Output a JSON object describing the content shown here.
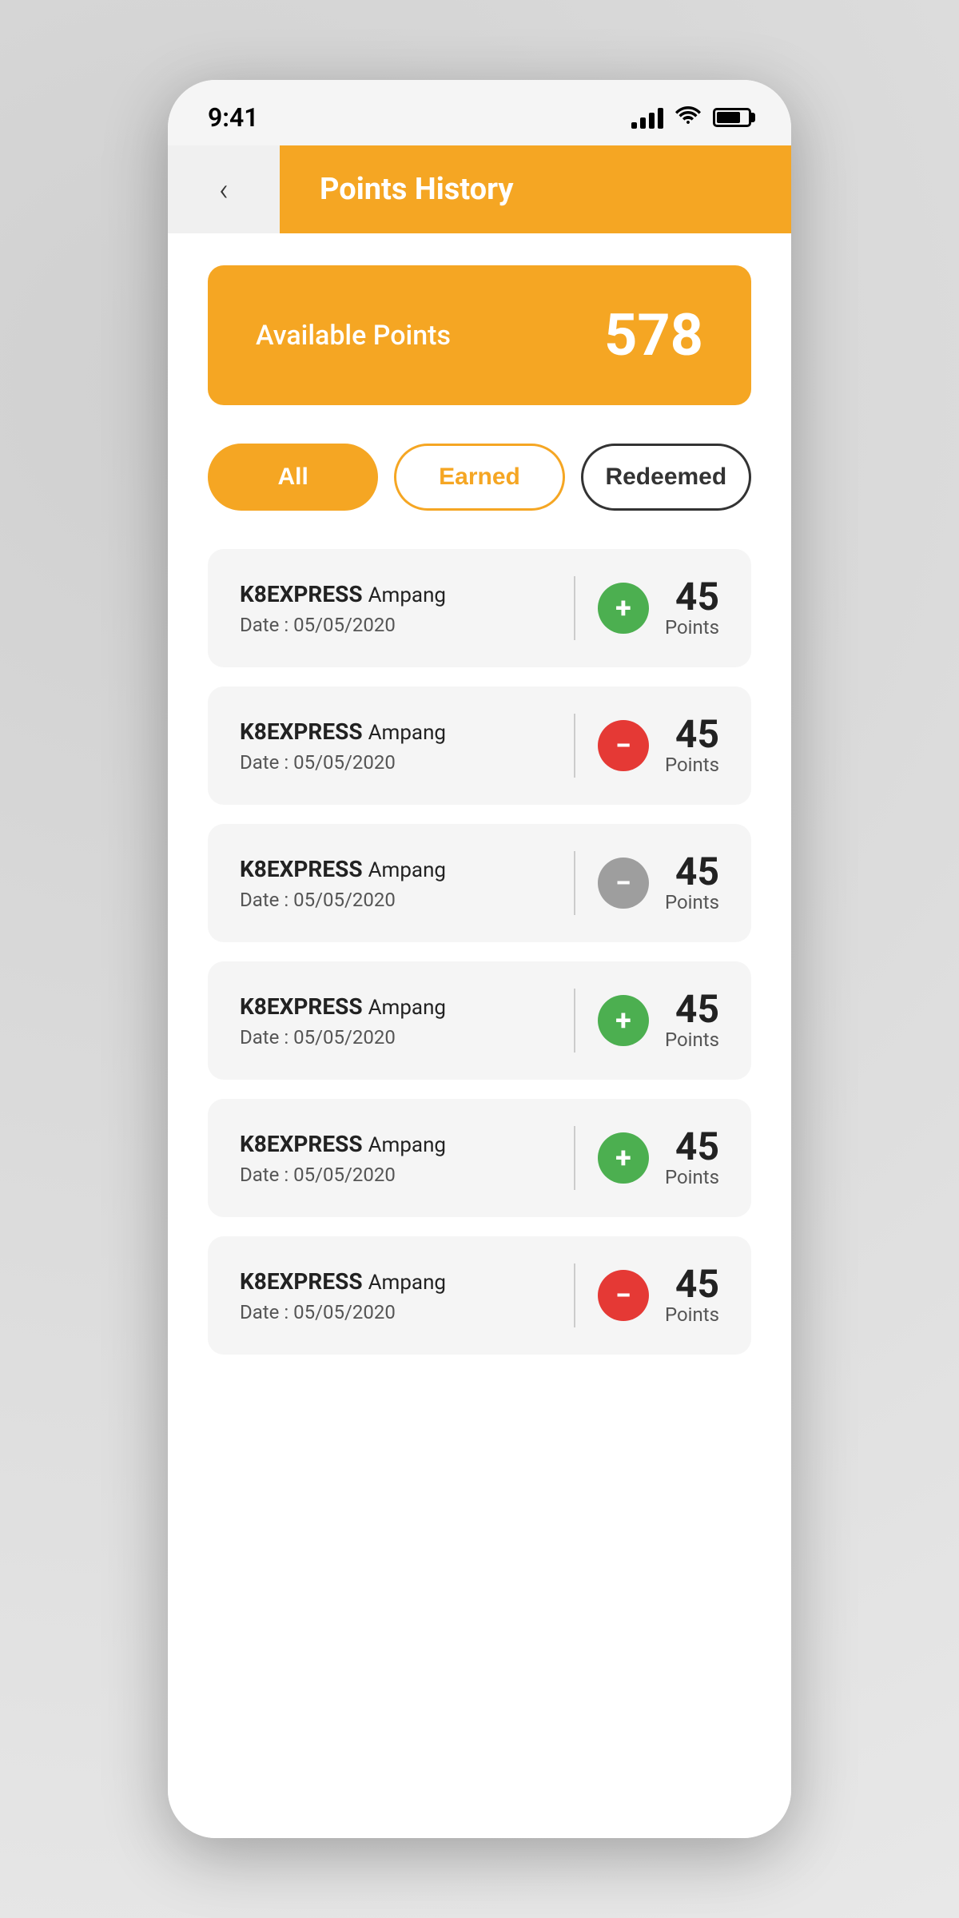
{
  "status_bar": {
    "time": "9:41",
    "signal_label": "signal",
    "wifi_label": "wifi",
    "battery_label": "battery"
  },
  "header": {
    "back_label": "‹",
    "title": "Points History"
  },
  "points_card": {
    "label": "Available Points",
    "value": "578"
  },
  "filter_tabs": [
    {
      "id": "all",
      "label": "All",
      "state": "active-all"
    },
    {
      "id": "earned",
      "label": "Earned",
      "state": "active-earned"
    },
    {
      "id": "redeemed",
      "label": "Redeemed",
      "state": "active-redeemed"
    }
  ],
  "transactions": [
    {
      "store": "K8EXPRESS",
      "branch": "Ampang",
      "date": "Date : 05/05/2020",
      "points": "45",
      "points_label": "Points",
      "type": "earn",
      "icon_type": "green"
    },
    {
      "store": "K8EXPRESS",
      "branch": "Ampang",
      "date": "Date : 05/05/2020",
      "points": "45",
      "points_label": "Points",
      "type": "redeem",
      "icon_type": "red"
    },
    {
      "store": "K8EXPRESS",
      "branch": "Ampang",
      "date": "Date : 05/05/2020",
      "points": "45",
      "points_label": "Points",
      "type": "redeem",
      "icon_type": "gray"
    },
    {
      "store": "K8EXPRESS",
      "branch": "Ampang",
      "date": "Date : 05/05/2020",
      "points": "45",
      "points_label": "Points",
      "type": "earn",
      "icon_type": "green"
    },
    {
      "store": "K8EXPRESS",
      "branch": "Ampang",
      "date": "Date : 05/05/2020",
      "points": "45",
      "points_label": "Points",
      "type": "earn",
      "icon_type": "green"
    },
    {
      "store": "K8EXPRESS",
      "branch": "Ampang",
      "date": "Date : 05/05/2020",
      "points": "45",
      "points_label": "Points",
      "type": "redeem",
      "icon_type": "red"
    }
  ],
  "colors": {
    "primary": "#F5A623",
    "green": "#4CAF50",
    "red": "#e53935",
    "gray": "#9e9e9e"
  }
}
